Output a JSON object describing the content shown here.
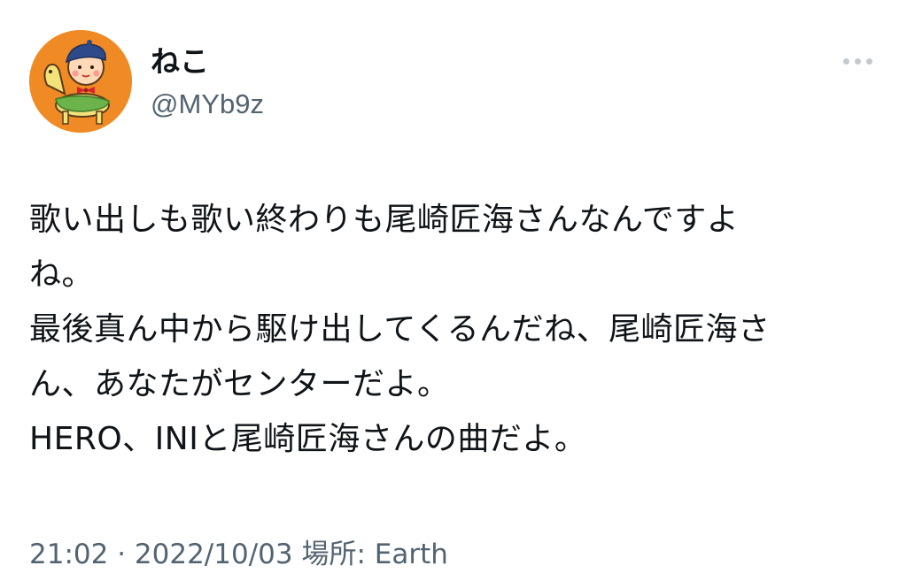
{
  "user": {
    "display_name": "ねこ",
    "handle": "@MYb9z",
    "avatar_icon": "cartoon-child-on-rocking-horse-avatar",
    "avatar_bg_color": "#f08a24"
  },
  "more_icon": "more-horizontal-icon",
  "tweet": {
    "lines": [
      "歌い出しも歌い終わりも尾崎匠海さんなんですよ",
      "ね。",
      "最後真ん中から駆け出してくるんだね、尾崎匠海さ",
      "ん、あなたがセンターだよ。",
      "HERO、INIと尾崎匠海さんの曲だよ。"
    ]
  },
  "meta": {
    "time": "21:02",
    "separator": " · ",
    "date": "2022/10/03",
    "location_label": " 場所: ",
    "location": "Earth"
  }
}
